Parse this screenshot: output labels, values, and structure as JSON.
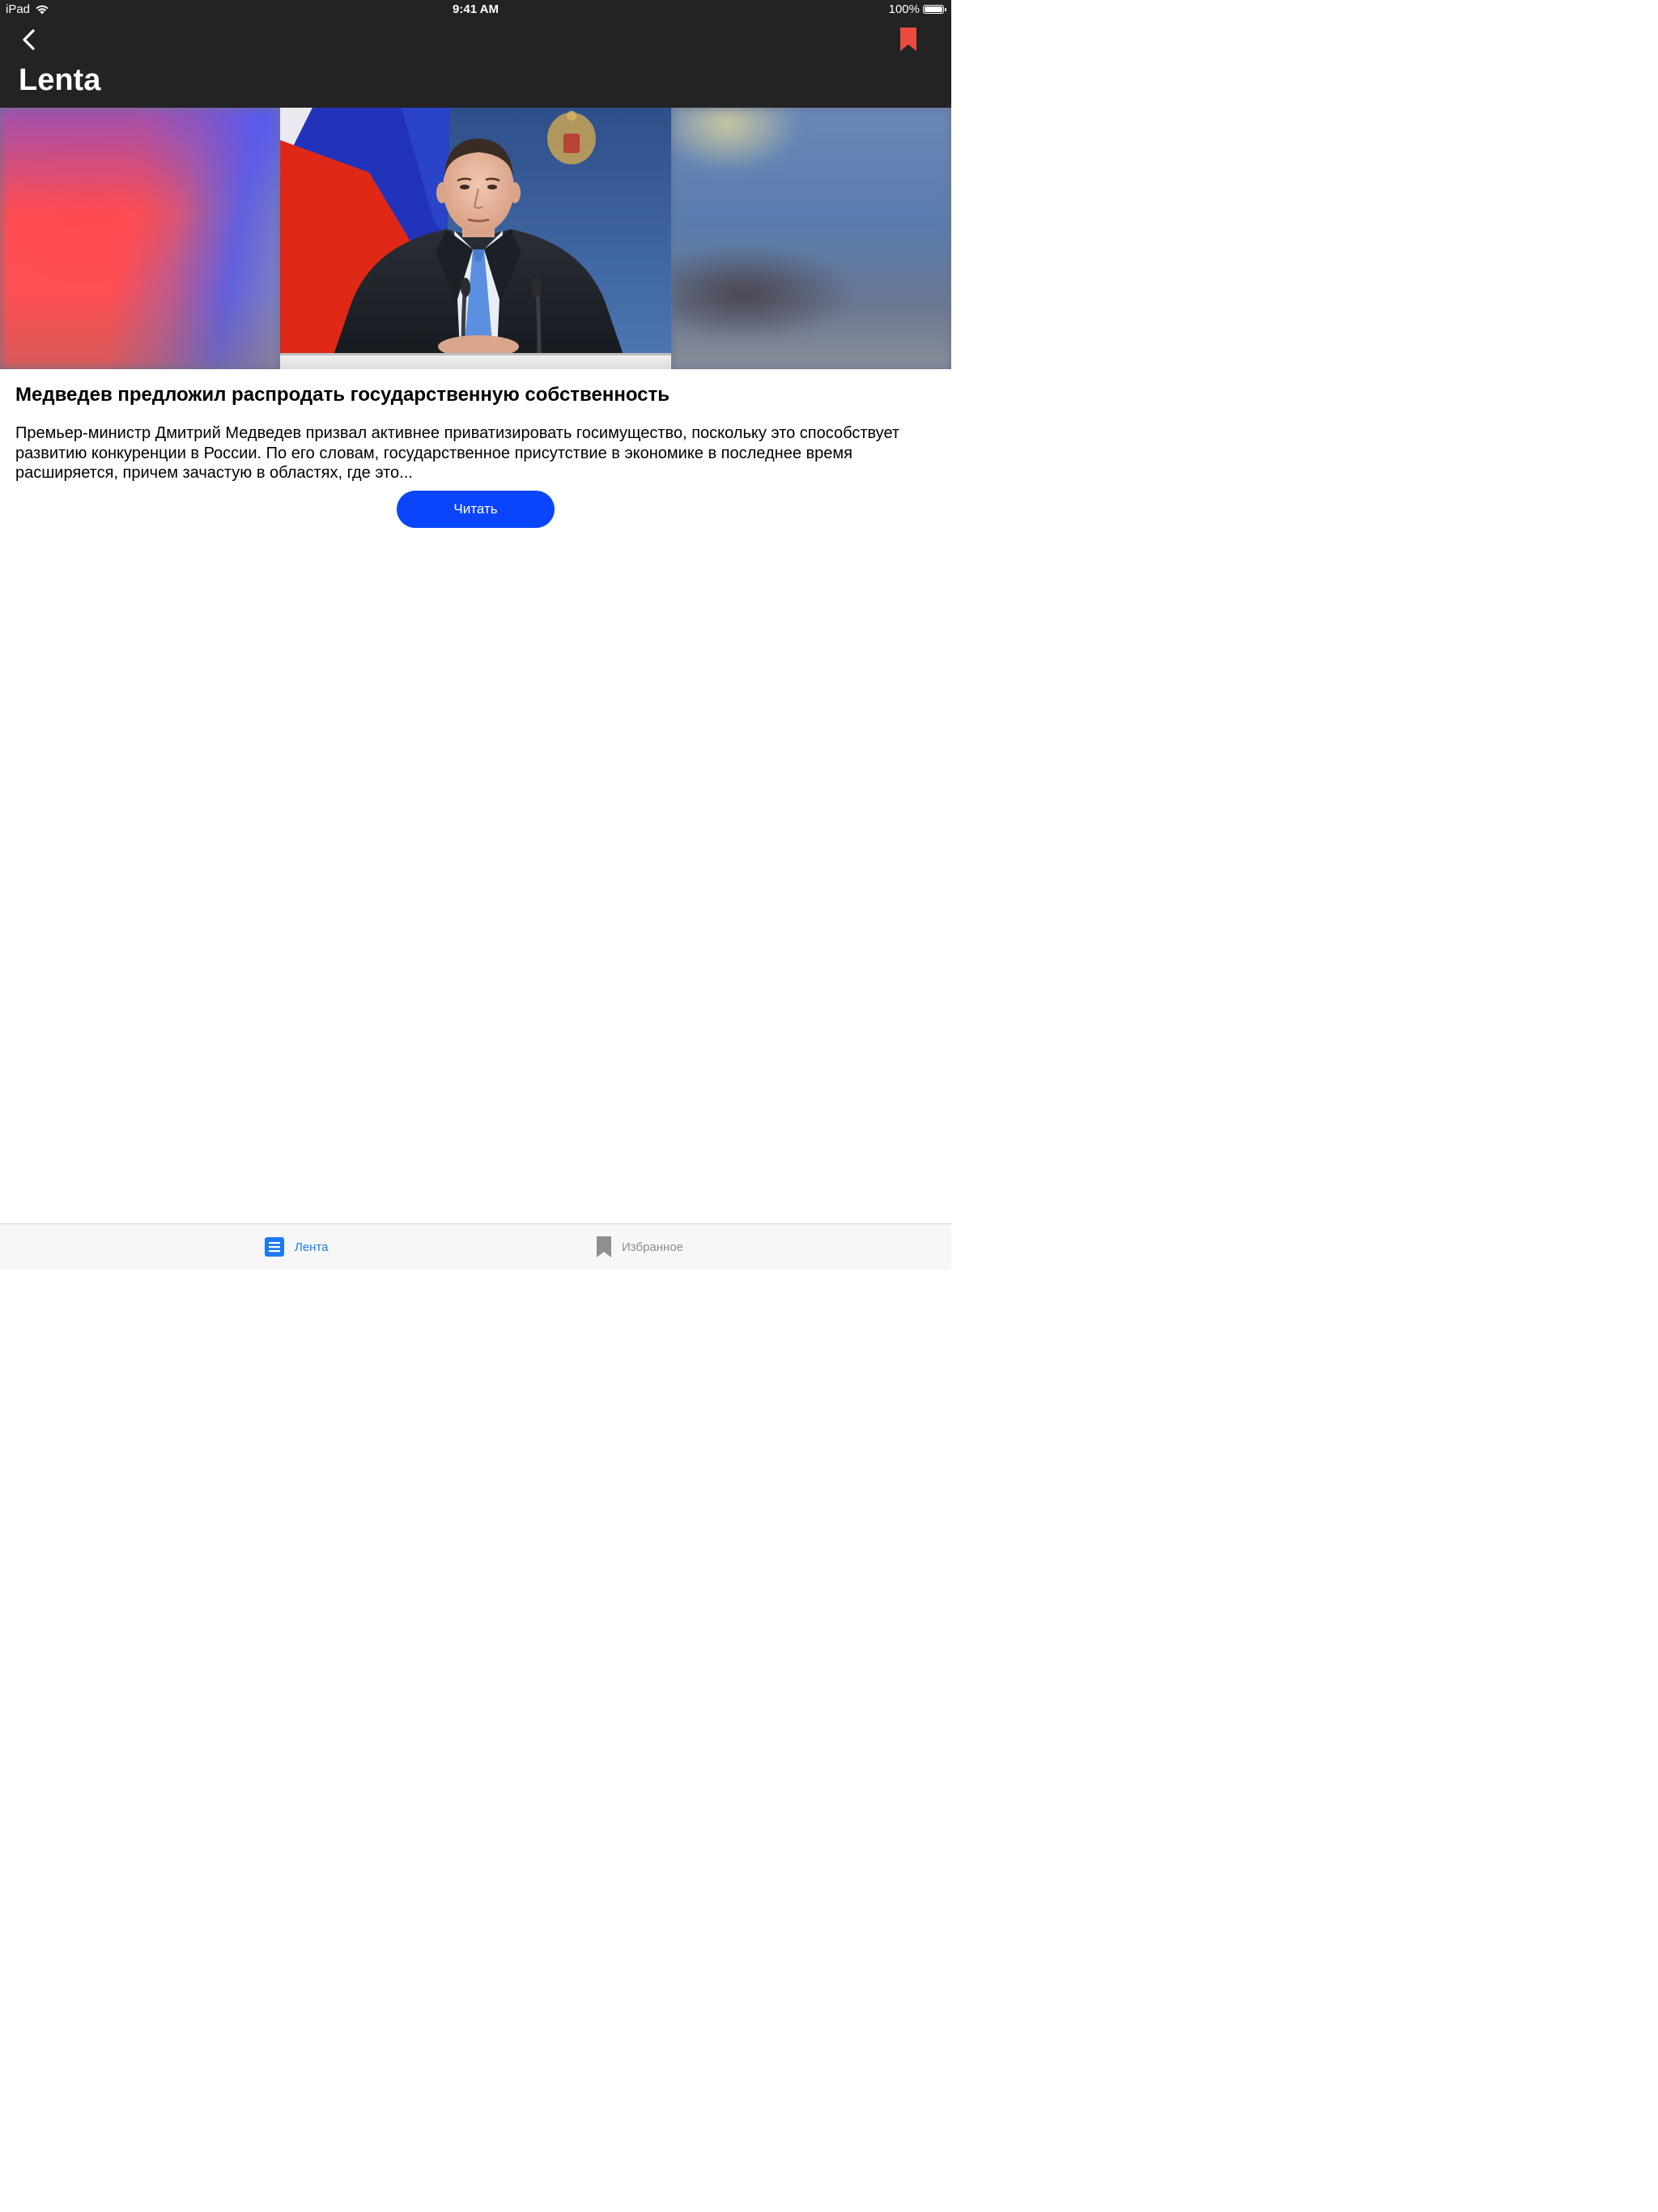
{
  "status_bar": {
    "device": "iPad",
    "time": "9:41 AM",
    "battery": "100%",
    "battery_level": 1.0
  },
  "nav": {
    "title": "Lenta",
    "icons": {
      "back": "chevron-left-icon",
      "bookmark": "bookmark-icon"
    },
    "bookmark_color": "#e94b3f",
    "background": "#232323"
  },
  "article": {
    "title": "Медведев предложил распродать государственную собственность",
    "summary": "Премьер-министр Дмитрий Медведев призвал активнее приватизировать госимущество, поскольку это способствует развитию конкуренции в России. По его словам, государственное присутствие в экономике в последнее время расширяется, причем зачастую в областях, где это...",
    "read_button_label": "Читать",
    "read_button_color": "#0b45fb"
  },
  "tab_bar": {
    "tabs": [
      {
        "label": "Лента",
        "icon": "list-icon",
        "active": true
      },
      {
        "label": "Избранное",
        "icon": "bookmark-icon",
        "active": false
      }
    ],
    "active_color": "#1a7bf6",
    "inactive_color": "#8e8e93"
  }
}
